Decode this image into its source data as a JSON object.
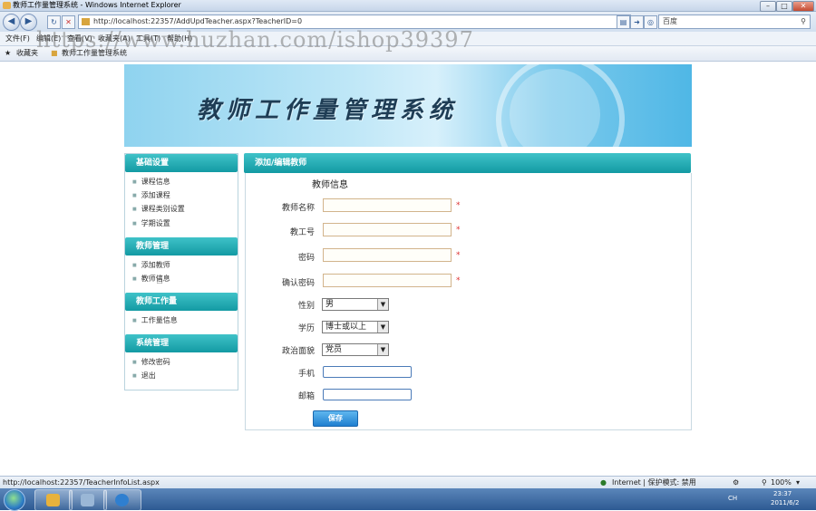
{
  "window": {
    "title": "教师工作量管理系统 - Windows Internet Explorer",
    "min": "–",
    "max": "□",
    "close": "✕"
  },
  "browser": {
    "back": "◀",
    "forward": "▶",
    "refresh": "↻",
    "stop": "✕",
    "url": "http://localhost:22357/AddUpdTeacher.aspx?TeacherID=0",
    "search_placeholder": "百度",
    "menu": [
      "文件(F)",
      "编辑(E)",
      "查看(V)",
      "收藏夹(A)",
      "工具(T)",
      "帮助(H)"
    ],
    "favorites_label": "收藏夹",
    "tab_label": "教师工作量管理系统"
  },
  "watermark": "https://www.huzhan.com/ishop39397",
  "banner": {
    "title": "教师工作量管理系统"
  },
  "sidebar": {
    "sections": [
      {
        "title": "基础设置",
        "items": [
          "课程信息",
          "添加课程",
          "课程类别设置",
          "学期设置"
        ]
      },
      {
        "title": "教师管理",
        "items": [
          "添加教师",
          "教师信息"
        ]
      },
      {
        "title": "教师工作量",
        "items": [
          "工作量信息"
        ]
      },
      {
        "title": "系统管理",
        "items": [
          "修改密码",
          "退出"
        ]
      }
    ]
  },
  "main": {
    "header": "添加/编辑教师",
    "form_title": "教师信息",
    "fields": {
      "name": "教师名称",
      "number": "教工号",
      "password": "密码",
      "confirm_password": "确认密码",
      "gender": "性别",
      "education": "学历",
      "politics": "政治面貌",
      "phone": "手机",
      "email": "邮箱"
    },
    "required_mark": "*",
    "gender_value": "男",
    "education_value": "博士或以上",
    "politics_value": "党员",
    "dropdown_arrow": "▼",
    "save_label": "保存"
  },
  "statusbar": {
    "link": "http://localhost:22357/TeacherInfoList.aspx",
    "zone": "Internet | 保护模式: 禁用",
    "zoom": "100%"
  },
  "taskbar": {
    "time": "23:37",
    "date": "2011/6/2",
    "lang": "CH"
  },
  "colors": {
    "accent": "#139aa3",
    "button": "#1f7fd0",
    "required": "#dd3333"
  }
}
